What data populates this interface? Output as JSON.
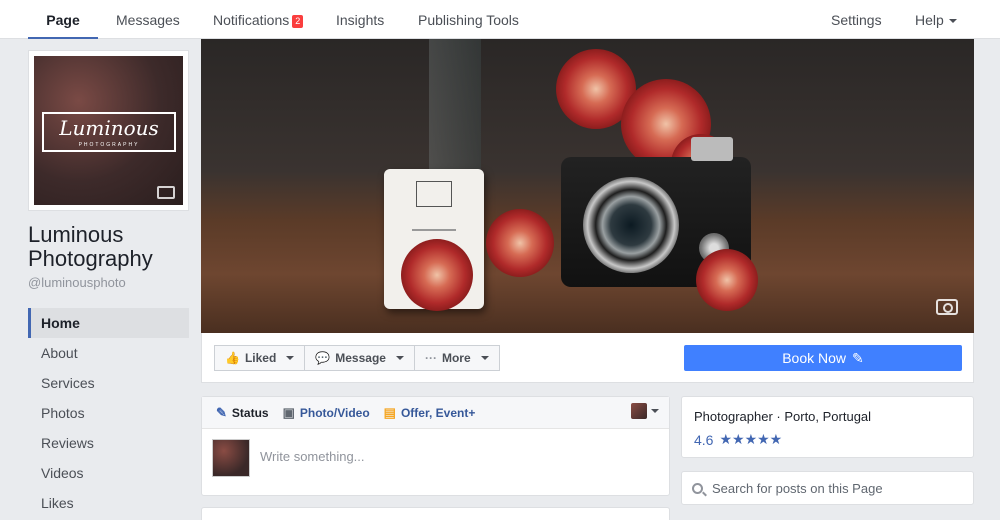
{
  "topnav": {
    "tabs": [
      {
        "label": "Page"
      },
      {
        "label": "Messages"
      },
      {
        "label": "Notifications",
        "badge": "2"
      },
      {
        "label": "Insights"
      },
      {
        "label": "Publishing Tools"
      }
    ],
    "settings": "Settings",
    "help": "Help"
  },
  "profile": {
    "logo_text": "Luminous",
    "logo_sub": "PHOTOGRAPHY",
    "name": "Luminous Photography",
    "handle": "@luminousphoto"
  },
  "sidebar": {
    "items": [
      {
        "label": "Home",
        "active": true
      },
      {
        "label": "About"
      },
      {
        "label": "Services"
      },
      {
        "label": "Photos"
      },
      {
        "label": "Reviews"
      },
      {
        "label": "Videos"
      },
      {
        "label": "Likes"
      }
    ]
  },
  "actions": {
    "liked": "Liked",
    "message": "Message",
    "more": "More",
    "book_now": "Book Now"
  },
  "composer": {
    "tabs": [
      {
        "label": "Status",
        "icon": "pencil-icon"
      },
      {
        "label": "Photo/Video",
        "icon": "camera-icon"
      },
      {
        "label": "Offer, Event+",
        "icon": "offer-icon"
      }
    ],
    "placeholder": "Write something..."
  },
  "info": {
    "category": "Photographer · Porto, Portugal",
    "rating": "4.6",
    "stars": "★★★★★"
  },
  "search": {
    "placeholder": "Search for posts on this Page"
  },
  "colors": {
    "brand_blue": "#4267b2",
    "book_now": "#4080ff",
    "badge_red": "#fa3e3e"
  }
}
